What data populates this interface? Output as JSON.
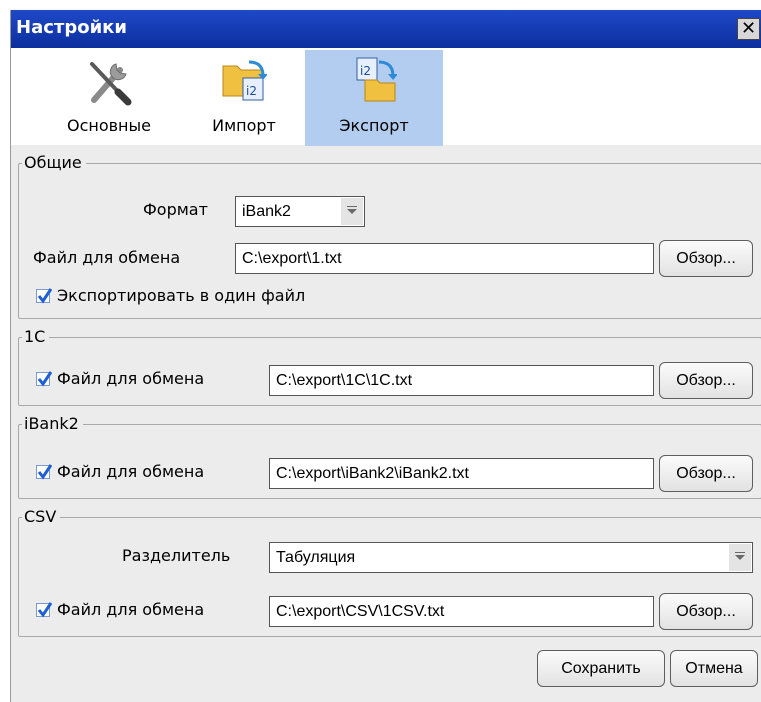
{
  "window": {
    "title": "Настройки",
    "close_glyph": "✕"
  },
  "tabs": [
    {
      "label": "Основные",
      "icon": "tools-icon"
    },
    {
      "label": "Импорт",
      "icon": "import-icon"
    },
    {
      "label": "Экспорт",
      "icon": "export-icon",
      "active": true
    }
  ],
  "general": {
    "legend": "Общие",
    "format_label": "Формат",
    "format_value": "iBank2",
    "file_label": "Файл для обмена",
    "file_value": "C:\\export\\1.txt",
    "browse_label": "Обзор...",
    "single_file_label": "Экспортировать в один файл",
    "single_file_checked": true
  },
  "onec": {
    "legend": "1C",
    "file_label": "Файл для обмена",
    "file_checked": true,
    "file_value": "C:\\export\\1C\\1C.txt",
    "browse_label": "Обзор..."
  },
  "ibank2": {
    "legend": "iBank2",
    "file_label": "Файл для обмена",
    "file_checked": true,
    "file_value": "C:\\export\\iBank2\\iBank2.txt",
    "browse_label": "Обзор..."
  },
  "csv": {
    "legend": "CSV",
    "separator_label": "Разделитель",
    "separator_value": "Табуляция",
    "file_label": "Файл для обмена",
    "file_checked": true,
    "file_value": "C:\\export\\CSV\\1CSV.txt",
    "browse_label": "Обзор..."
  },
  "footer": {
    "save_label": "Сохранить",
    "cancel_label": "Отмена"
  },
  "colors": {
    "titlebar": "#1f49c8",
    "active_tab": "#b3cdf0",
    "check": "#1f5fd6"
  }
}
